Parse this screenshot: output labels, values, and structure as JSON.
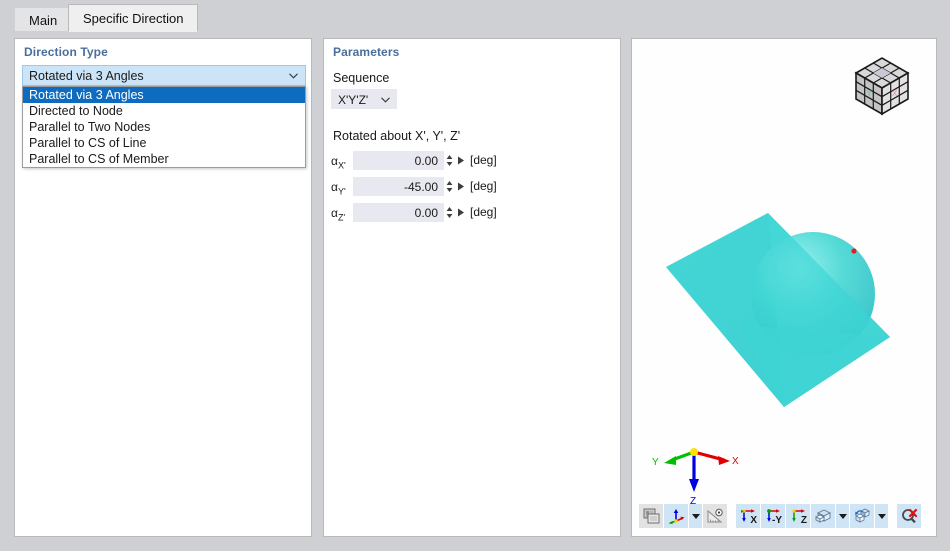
{
  "window": {
    "tabs": [
      {
        "label": "Main",
        "active": false
      },
      {
        "label": "Specific Direction",
        "active": true
      }
    ]
  },
  "direction_type_panel": {
    "header": "Direction Type",
    "combo": {
      "selected": "Rotated via 3 Angles",
      "expanded": true,
      "options": [
        "Rotated via 3 Angles",
        "Directed to Node",
        "Parallel to Two Nodes",
        "Parallel to CS of Line",
        "Parallel to CS of Member"
      ],
      "highlighted_index": 0
    }
  },
  "parameters_panel": {
    "header": "Parameters",
    "sequence_label": "Sequence",
    "sequence_value": "X'Y'Z'",
    "rotated_about_label": "Rotated about X', Y', Z'",
    "angles": [
      {
        "symbol": "α",
        "subscript": "X'",
        "value": "0.00",
        "unit": "[deg]"
      },
      {
        "symbol": "α",
        "subscript": "Y'",
        "value": "-45.00",
        "unit": "[deg]"
      },
      {
        "symbol": "α",
        "subscript": "Z'",
        "value": "0.00",
        "unit": "[deg]"
      }
    ]
  },
  "viewport": {
    "navigation_cube": "view-cube",
    "axis_tripod": {
      "x_label": "X",
      "y_label": "Y",
      "z_label": "Z",
      "x_color": "#e00000",
      "y_color": "#00c000",
      "z_color": "#0000e0",
      "origin_color": "#ffe000"
    },
    "geometry": {
      "surface_color": "#3fd4d4",
      "node_marker_color": "#e02020"
    },
    "toolbar": [
      {
        "name": "print-screen",
        "label": "",
        "enabled": false,
        "dropdown": false
      },
      {
        "name": "coordinate-system",
        "label": "",
        "enabled": true,
        "dropdown": true
      },
      {
        "name": "measure",
        "label": "",
        "enabled": false,
        "dropdown": false
      },
      {
        "name": "view-in-x",
        "label": "X",
        "enabled": true,
        "dropdown": false
      },
      {
        "name": "view-in-minus-y",
        "label": "-Y",
        "enabled": true,
        "dropdown": false
      },
      {
        "name": "view-in-z",
        "label": "Z",
        "enabled": true,
        "dropdown": false
      },
      {
        "name": "render-mode",
        "label": "",
        "enabled": true,
        "dropdown": true
      },
      {
        "name": "rotate-model",
        "label": "",
        "enabled": true,
        "dropdown": true
      },
      {
        "name": "reset-zoom",
        "label": "",
        "enabled": true,
        "dropdown": false
      }
    ]
  }
}
